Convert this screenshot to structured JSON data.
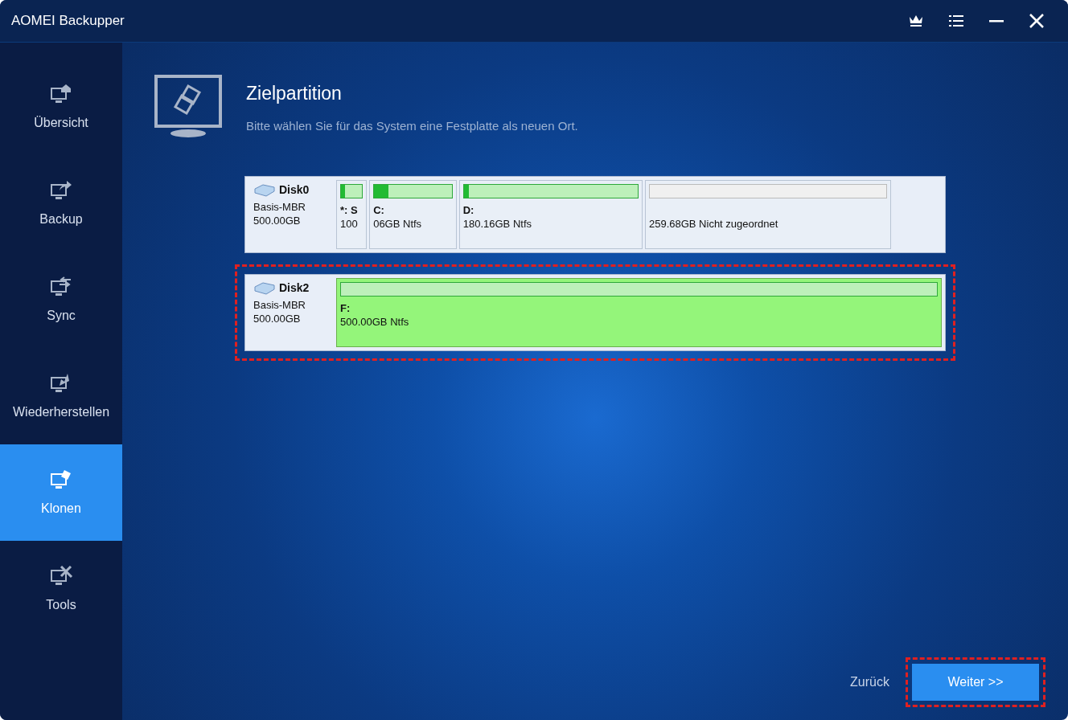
{
  "window": {
    "title": "AOMEI Backupper"
  },
  "sidebar": {
    "items": [
      {
        "label": "Übersicht",
        "selected": false
      },
      {
        "label": "Backup",
        "selected": false
      },
      {
        "label": "Sync",
        "selected": false
      },
      {
        "label": "Wiederherstellen",
        "selected": false
      },
      {
        "label": "Klonen",
        "selected": true
      },
      {
        "label": "Tools",
        "selected": false
      }
    ]
  },
  "header": {
    "title": "Zielpartition",
    "subtitle": "Bitte wählen Sie für das System eine Festplatte als neuen Ort."
  },
  "disks": [
    {
      "name": "Disk0",
      "type": "Basis-MBR",
      "size": "500.00GB",
      "selected": false,
      "partitions": [
        {
          "kind": "used",
          "label": "*: S",
          "size": "100",
          "level": 0.2
        },
        {
          "kind": "used",
          "label": "C:",
          "size": "06GB Ntfs",
          "level": 0.18
        },
        {
          "kind": "used",
          "label": "D:",
          "size": "180.16GB Ntfs",
          "level": 0.03
        },
        {
          "kind": "unallocated",
          "size": "259.68GB Nicht zugeordnet"
        }
      ]
    },
    {
      "name": "Disk2",
      "type": "Basis-MBR",
      "size": "500.00GB",
      "selected": true,
      "partitions": [
        {
          "kind": "used",
          "label": "F:",
          "size": "500.00GB Ntfs"
        }
      ]
    }
  ],
  "footer": {
    "back": "Zurück",
    "next": "Weiter >>"
  }
}
